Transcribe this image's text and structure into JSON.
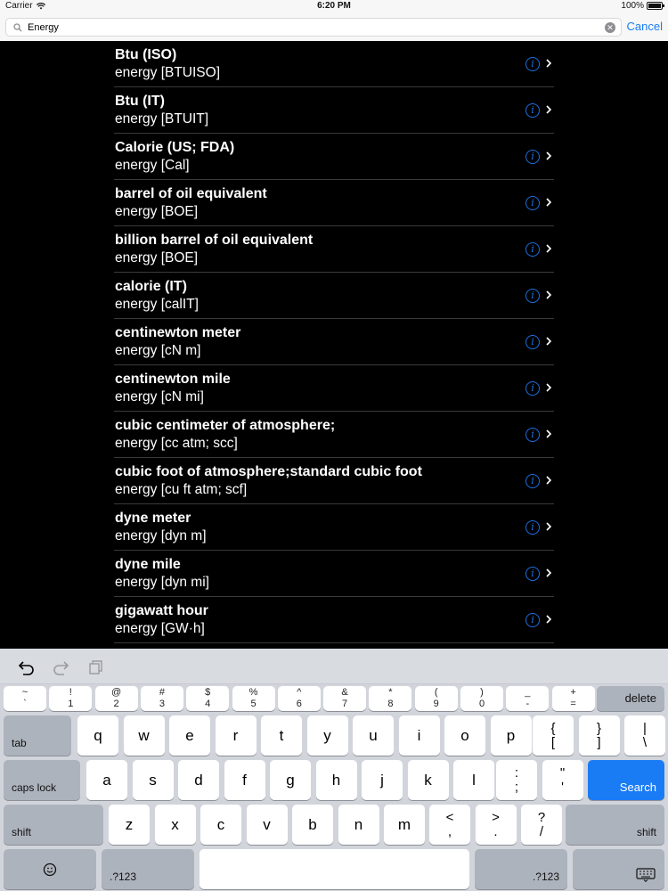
{
  "status": {
    "carrier": "Carrier",
    "time": "6:20 PM",
    "battery": "100%"
  },
  "search": {
    "value": "Energy",
    "cancel_label": "Cancel"
  },
  "results": [
    {
      "title": "Btu (ISO)",
      "subtitle": "energy [BTUISO]"
    },
    {
      "title": "Btu (IT)",
      "subtitle": "energy [BTUIT]"
    },
    {
      "title": "Calorie (US; FDA)",
      "subtitle": "energy [Cal]"
    },
    {
      "title": "barrel of oil equivalent",
      "subtitle": "energy [BOE]"
    },
    {
      "title": "billion barrel of oil equivalent",
      "subtitle": "energy [BOE]"
    },
    {
      "title": "calorie (IT)",
      "subtitle": "energy [calIT]"
    },
    {
      "title": "centinewton meter",
      "subtitle": "energy [cN m]"
    },
    {
      "title": "centinewton mile",
      "subtitle": "energy [cN mi]"
    },
    {
      "title": "cubic centimeter of atmosphere;",
      "subtitle": "energy [cc atm; scc]"
    },
    {
      "title": "cubic foot of atmosphere;standard cubic foot",
      "subtitle": "energy [cu ft atm; scf]"
    },
    {
      "title": "dyne meter",
      "subtitle": "energy [dyn m]"
    },
    {
      "title": "dyne mile",
      "subtitle": "energy [dyn mi]"
    },
    {
      "title": "gigawatt hour",
      "subtitle": "energy [GW·h]"
    }
  ],
  "keyboard": {
    "num_row": [
      {
        "top": "~",
        "bottom": "`"
      },
      {
        "top": "!",
        "bottom": "1"
      },
      {
        "top": "@",
        "bottom": "2"
      },
      {
        "top": "#",
        "bottom": "3"
      },
      {
        "top": "$",
        "bottom": "4"
      },
      {
        "top": "%",
        "bottom": "5"
      },
      {
        "top": "^",
        "bottom": "6"
      },
      {
        "top": "&",
        "bottom": "7"
      },
      {
        "top": "*",
        "bottom": "8"
      },
      {
        "top": "(",
        "bottom": "9"
      },
      {
        "top": ")",
        "bottom": "0"
      },
      {
        "top": "_",
        "bottom": "-"
      },
      {
        "top": "+",
        "bottom": "="
      }
    ],
    "delete_label": "delete",
    "tab_label": "tab",
    "row1": [
      "q",
      "w",
      "e",
      "r",
      "t",
      "y",
      "u",
      "i",
      "o",
      "p"
    ],
    "row1_sym": [
      {
        "top": "{",
        "bottom": "["
      },
      {
        "top": "}",
        "bottom": "]"
      },
      {
        "top": "|",
        "bottom": "\\"
      }
    ],
    "caps_label": "caps lock",
    "row2": [
      "a",
      "s",
      "d",
      "f",
      "g",
      "h",
      "j",
      "k",
      "l"
    ],
    "row2_sym": [
      {
        "top": ":",
        "bottom": ";"
      },
      {
        "top": "\"",
        "bottom": "'"
      }
    ],
    "search_label": "Search",
    "shift_label": "shift",
    "row3": [
      "z",
      "x",
      "c",
      "v",
      "b",
      "n",
      "m"
    ],
    "row3_sym": [
      {
        "top": "<",
        "bottom": ","
      },
      {
        "top": ">",
        "bottom": "."
      },
      {
        "top": "?",
        "bottom": "/"
      }
    ],
    "numbers_label": ".?123"
  },
  "colors": {
    "accent": "#1a7cf5",
    "list_bg": "#000000",
    "info_icon": "#1f6fe0"
  }
}
